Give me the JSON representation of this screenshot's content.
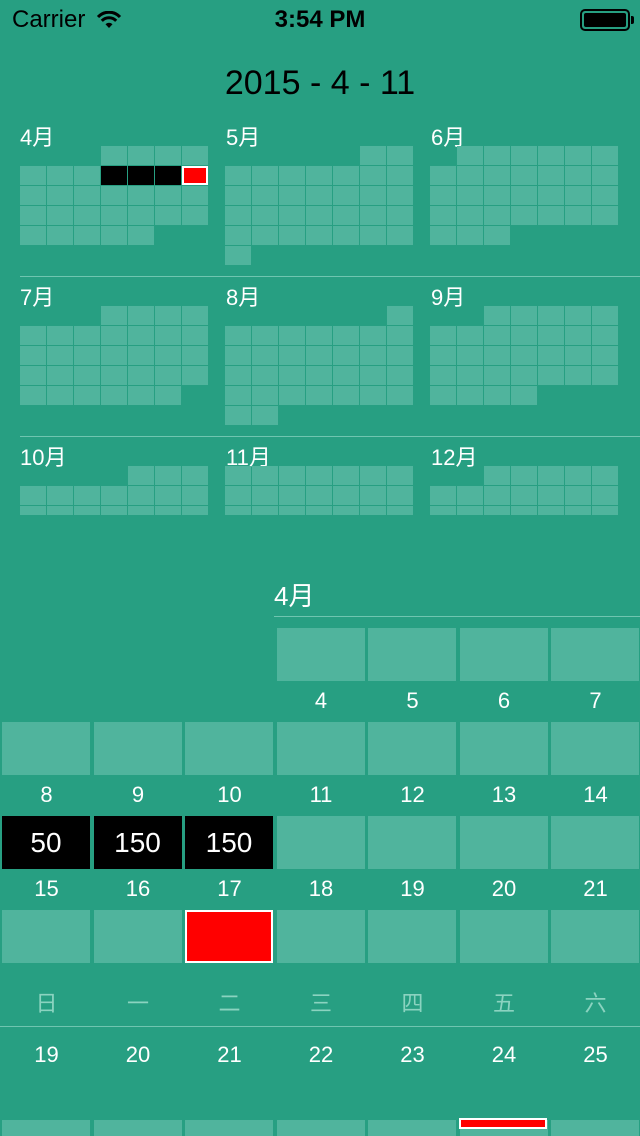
{
  "status": {
    "carrier": "Carrier",
    "time": "3:54 PM"
  },
  "header": {
    "date": "2015 - 4 - 11"
  },
  "months": [
    "4月",
    "5月",
    "6月",
    "7月",
    "8月",
    "9月",
    "10月",
    "11月",
    "12月"
  ],
  "detail": {
    "month_title": "4月",
    "row_days": [
      [
        "",
        "",
        "",
        "4",
        "5",
        "6",
        "7"
      ],
      [
        "8",
        "9",
        "10",
        "11",
        "12",
        "13",
        "14"
      ],
      [
        "15",
        "16",
        "17",
        "18",
        "19",
        "20",
        "21"
      ]
    ],
    "values": [
      "50",
      "150",
      "150"
    ]
  },
  "weekdays": [
    "日",
    "一",
    "二",
    "三",
    "四",
    "五",
    "六"
  ],
  "week_numbers": [
    "19",
    "20",
    "21",
    "22",
    "23",
    "24",
    "25"
  ],
  "colors": {
    "background": "#279f82",
    "cell": "#50b49d",
    "highlight": "#ff0000",
    "filled": "#000000"
  }
}
